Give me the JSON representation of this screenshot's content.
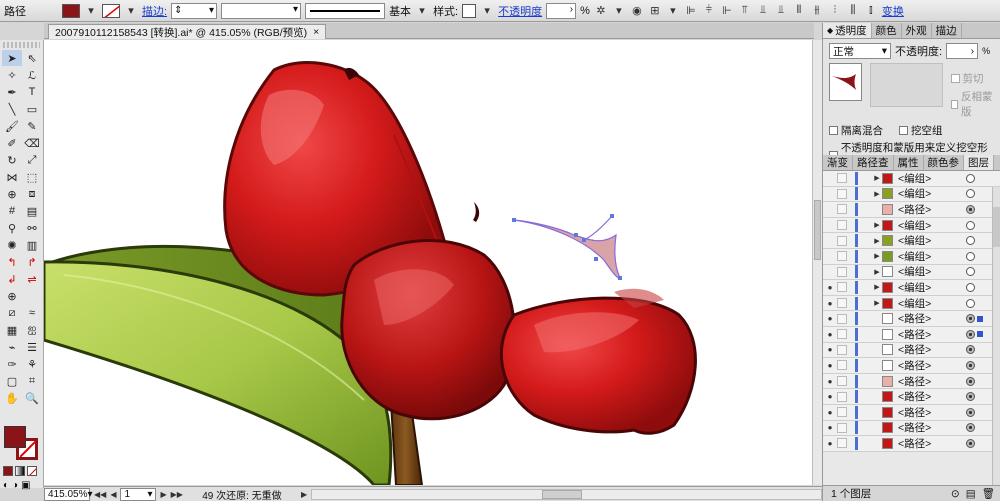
{
  "control_bar": {
    "object_type": "路径",
    "fill_color": "#8c1418",
    "stroke_label": "描边:",
    "stroke_style_label": "基本",
    "style_label": "样式:",
    "opacity_label": "不透明度",
    "opacity_value": "",
    "opacity_unit": "%",
    "transform_label": "变换"
  },
  "document": {
    "tab_title": "20079101121585​43 [转换].ai* @ 415.05% (RGB/预览)",
    "close_glyph": "×"
  },
  "status_bar": {
    "zoom": "415.05%",
    "artboard": "1",
    "message": "49 次还原: 无重做"
  },
  "transparency_panel": {
    "tabs": [
      "透明度",
      "颜色",
      "外观",
      "描边"
    ],
    "blend_mode": "正常",
    "opacity_label": "不透明度:",
    "opacity_value": "",
    "opacity_unit": "%",
    "clip_label": "剪切",
    "invert_mask_label": "反相蒙版",
    "isolate_blending_label": "隔离混合",
    "knockout_group_label": "挖空组",
    "opacity_mask_label": "不透明度和蒙版用来定义挖空形状"
  },
  "layers_panel": {
    "tabs": [
      "渐变",
      "路径查",
      "属性",
      "颜色参",
      "图层"
    ],
    "rows": [
      {
        "name": "<编组>",
        "group": true,
        "eye": false,
        "thumb": "#c01818",
        "target": false,
        "selected": false
      },
      {
        "name": "<编组>",
        "group": true,
        "eye": false,
        "thumb": "#8aa020",
        "target": false,
        "selected": false
      },
      {
        "name": "<路径>",
        "group": false,
        "eye": false,
        "thumb": "#e8b0a8",
        "target": true,
        "selected": false
      },
      {
        "name": "<编组>",
        "group": true,
        "eye": false,
        "thumb": "#c01818",
        "target": false,
        "selected": false
      },
      {
        "name": "<编组>",
        "group": true,
        "eye": false,
        "thumb": "#8aa020",
        "target": false,
        "selected": false
      },
      {
        "name": "<编组>",
        "group": true,
        "eye": false,
        "thumb": "#7a9a20",
        "target": false,
        "selected": false
      },
      {
        "name": "<编组>",
        "group": true,
        "eye": false,
        "thumb": "#ffffff",
        "target": false,
        "selected": false
      },
      {
        "name": "<编组>",
        "group": true,
        "eye": true,
        "thumb": "#c01818",
        "target": false,
        "selected": false
      },
      {
        "name": "<编组>",
        "group": true,
        "eye": true,
        "thumb": "#c01818",
        "target": false,
        "selected": false
      },
      {
        "name": "<路径>",
        "group": false,
        "eye": true,
        "thumb": "#ffffff",
        "target": true,
        "selected": true
      },
      {
        "name": "<路径>",
        "group": false,
        "eye": true,
        "thumb": "#ffffff",
        "target": true,
        "selected": true
      },
      {
        "name": "<路径>",
        "group": false,
        "eye": true,
        "thumb": "#ffffff",
        "target": true,
        "selected": false
      },
      {
        "name": "<路径>",
        "group": false,
        "eye": true,
        "thumb": "#ffffff",
        "target": true,
        "selected": false
      },
      {
        "name": "<路径>",
        "group": false,
        "eye": true,
        "thumb": "#e8b0a8",
        "target": true,
        "selected": false
      },
      {
        "name": "<路径>",
        "group": false,
        "eye": true,
        "thumb": "#c01818",
        "target": true,
        "selected": false
      },
      {
        "name": "<路径>",
        "group": false,
        "eye": true,
        "thumb": "#c01818",
        "target": true,
        "selected": false
      },
      {
        "name": "<路径>",
        "group": false,
        "eye": true,
        "thumb": "#c01818",
        "target": true,
        "selected": false
      },
      {
        "name": "<路径>",
        "group": false,
        "eye": true,
        "thumb": "#c01818",
        "target": true,
        "selected": false
      }
    ],
    "footer": "1 个图层"
  }
}
